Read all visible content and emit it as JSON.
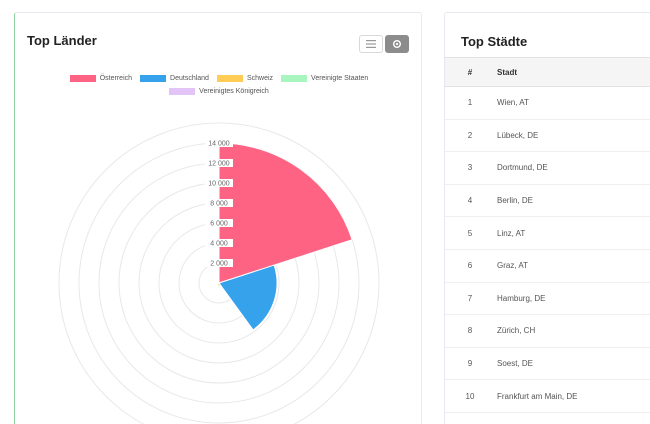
{
  "countries_card": {
    "title": "Top Länder",
    "menu_icon": "menu-icon",
    "settings_icon": "gear-icon"
  },
  "cities_card": {
    "title": "Top Städte",
    "columns": {
      "rank": "#",
      "city": "Stadt"
    },
    "rows": [
      {
        "rank": "1",
        "city": "Wien, AT"
      },
      {
        "rank": "2",
        "city": "Lübeck, DE"
      },
      {
        "rank": "3",
        "city": "Dortmund, DE"
      },
      {
        "rank": "4",
        "city": "Berlin, DE"
      },
      {
        "rank": "5",
        "city": "Linz, AT"
      },
      {
        "rank": "6",
        "city": "Graz, AT"
      },
      {
        "rank": "7",
        "city": "Hamburg, DE"
      },
      {
        "rank": "8",
        "city": "Zürich, CH"
      },
      {
        "rank": "9",
        "city": "Soest, DE"
      },
      {
        "rank": "10",
        "city": "Frankfurt am Main, DE"
      }
    ]
  },
  "chart_data": {
    "type": "polarArea",
    "title": "Top Länder",
    "categories": [
      "Österreich",
      "Deutschland",
      "Schweiz",
      "Vereinigte Staaten",
      "Vereinigtes Königreich"
    ],
    "values": [
      14000,
      5800,
      300,
      0,
      0
    ],
    "colors": [
      "#ff6384",
      "#36a2eb",
      "#ffcd56",
      "#a8f5c0",
      "#e2c4f7"
    ],
    "r_ticks": [
      "2 000",
      "4 000",
      "6 000",
      "8 000",
      "10 000",
      "12 000",
      "14 000"
    ],
    "r_max": 16000,
    "legend_position": "top"
  }
}
